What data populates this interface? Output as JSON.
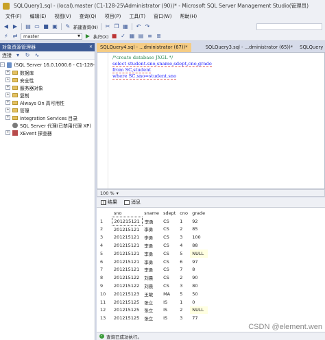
{
  "window": {
    "title": "SQLQuery1.sql - (local).master (C1-128-25\\Administrator (90))* - Microsoft SQL Server Management Studio(管理员)"
  },
  "menu": [
    "文件(F)",
    "编辑(E)",
    "视图(V)",
    "查询(Q)",
    "项目(P)",
    "工具(T)",
    "窗口(W)",
    "帮助(H)"
  ],
  "toolbar": {
    "new_query_label": "新建查询(N)",
    "database_value": "master",
    "execute_label": "执行(X)"
  },
  "object_explorer": {
    "title": "对象资源管理器",
    "connect_label": "连接",
    "server": "(SQL Server 16.0.1000.6 - C1-128-",
    "items": [
      "数据库",
      "安全性",
      "服务器对象",
      "复制",
      "Always On 高可用性",
      "管理",
      "Integration Services 目录",
      "SQL Server 代理(已禁用代理 XP)",
      "XEvent 探查器"
    ]
  },
  "tabs": [
    {
      "label": "SQLQuery4.sql - ...dministrator (67))*",
      "active": true
    },
    {
      "label": "SQLQuery3.sql - ...dministrator (65))*",
      "active": false
    },
    {
      "label": "SQLQuery",
      "active": false
    }
  ],
  "editor": {
    "lines": [
      "/*create database JXGL */",
      "select student.sno,sname,sdept,cno,grade",
      "from SC,student",
      "where SC.sno=student.sno"
    ]
  },
  "zoom": "100 %",
  "results": {
    "tabs": [
      "结果",
      "消息"
    ],
    "columns": [
      "sno",
      "sname",
      "sdept",
      "cno",
      "grade"
    ],
    "rows": [
      [
        "1",
        "201215121",
        "李勇",
        "CS",
        "1",
        "92"
      ],
      [
        "2",
        "201215121",
        "李勇",
        "CS",
        "2",
        "85"
      ],
      [
        "3",
        "201215121",
        "李勇",
        "CS",
        "3",
        "100"
      ],
      [
        "4",
        "201215121",
        "李勇",
        "CS",
        "4",
        "88"
      ],
      [
        "5",
        "201215121",
        "李勇",
        "CS",
        "5",
        "NULL"
      ],
      [
        "6",
        "201215121",
        "李勇",
        "CS",
        "6",
        "97"
      ],
      [
        "7",
        "201215121",
        "李勇",
        "CS",
        "7",
        "8"
      ],
      [
        "8",
        "201215122",
        "刘晨",
        "CS",
        "2",
        "90"
      ],
      [
        "9",
        "201215122",
        "刘晨",
        "CS",
        "3",
        "80"
      ],
      [
        "10",
        "201215123",
        "王敏",
        "MA",
        "5",
        "50"
      ],
      [
        "11",
        "201215125",
        "张立",
        "IS",
        "1",
        "0"
      ],
      [
        "12",
        "201215125",
        "张立",
        "IS",
        "2",
        "NULL"
      ],
      [
        "13",
        "201215125",
        "张立",
        "IS",
        "3",
        "77"
      ]
    ]
  },
  "status": {
    "message": "查询已成功执行。"
  },
  "watermark": "CSDN @element.wen"
}
